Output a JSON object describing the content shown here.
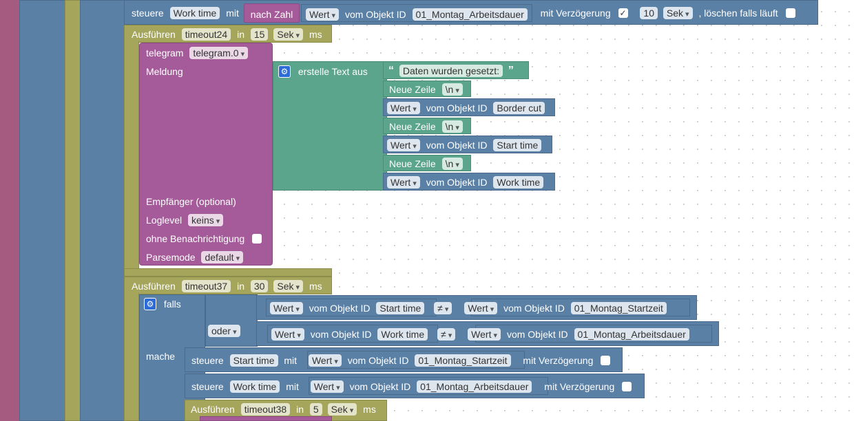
{
  "common": {
    "steuere": "steuere",
    "mit": "mit",
    "wert": "Wert",
    "vom_objekt_id": "vom Objekt ID",
    "mit_verzoegerung": "mit Verzögerung",
    "ausfuehren": "Ausführen",
    "in": "in",
    "sek": "Sek",
    "ms": "ms",
    "neue_zeile": "Neue Zeile",
    "newline": "\\n",
    "check": "✓"
  },
  "top_block": {
    "target": "Work time",
    "nach_zahl": "nach Zahl",
    "object_id": "01_Montag_Arbeitsdauer",
    "delay_value": "10",
    "loeschen_label": ", löschen falls läuft"
  },
  "timeout24": {
    "name": "timeout24",
    "value": "15"
  },
  "telegram": {
    "label": "telegram",
    "instance": "telegram.0",
    "meldung": "Meldung",
    "empfaenger": "Empfänger (optional)",
    "loglevel_label": "Loglevel",
    "loglevel_value": "keins",
    "ohne_benachrichtigung": "ohne Benachrichtigung",
    "parsemode_label": "Parsemode",
    "parsemode_value": "default"
  },
  "text_block": {
    "label": "erstelle Text aus",
    "string": "Daten wurden gesetzt:",
    "id_border": "Border cut",
    "id_start": "Start time",
    "id_work": "Work time"
  },
  "timeout37": {
    "name": "timeout37",
    "value": "30"
  },
  "if_block": {
    "falls": "falls",
    "oder": "oder",
    "mache": "mache",
    "neq": "≠",
    "cond1_left_id": "Start time",
    "cond1_right_id": "01_Montag_Startzeit",
    "cond2_left_id": "Work time",
    "cond2_right_id": "01_Montag_Arbeitsdauer"
  },
  "set1": {
    "target": "Start time",
    "object_id": "01_Montag_Startzeit"
  },
  "set2": {
    "target": "Work time",
    "object_id": "01_Montag_Arbeitsdauer"
  },
  "timeout38": {
    "name": "timeout38",
    "value": "5"
  }
}
